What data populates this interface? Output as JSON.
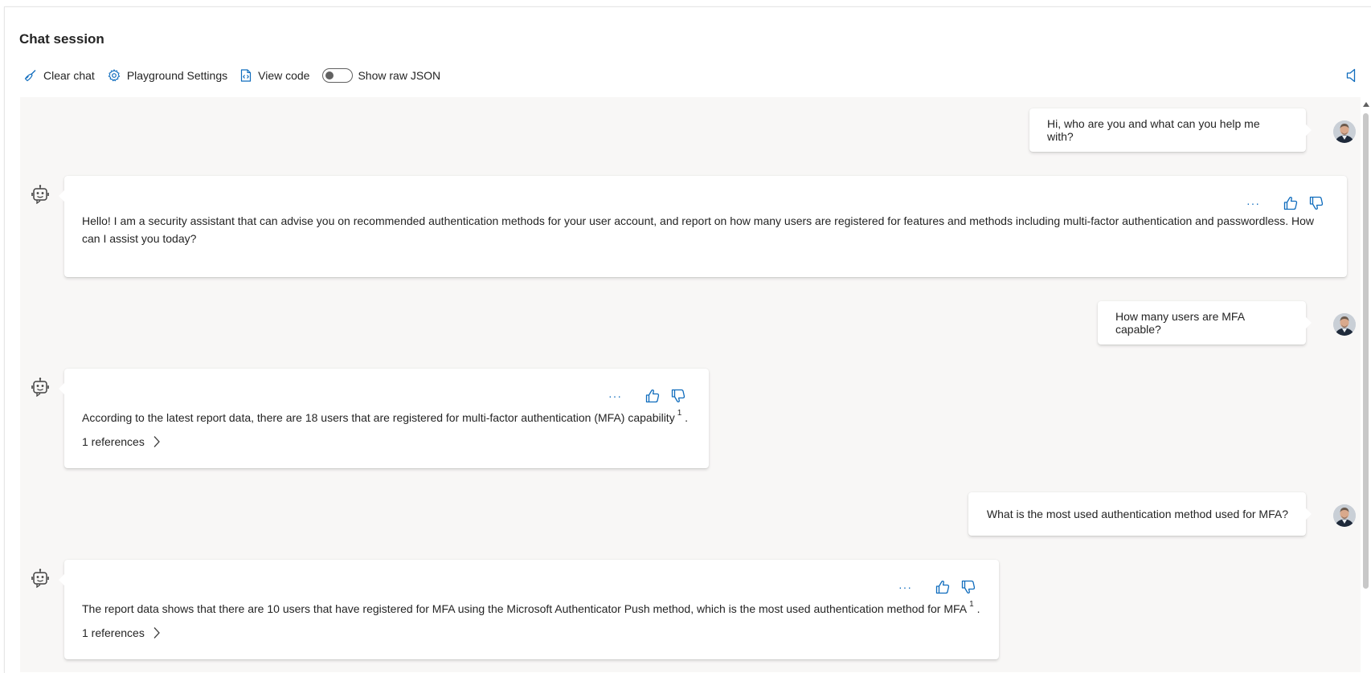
{
  "header": {
    "title": "Chat session"
  },
  "toolbar": {
    "clear_chat": "Clear chat",
    "playground_settings": "Playground Settings",
    "view_code": "View code",
    "show_raw_json": "Show raw JSON",
    "show_raw_json_on": false
  },
  "messages": [
    {
      "role": "user",
      "text": "Hi, who are you and what can you help me with?"
    },
    {
      "role": "assistant",
      "text": "Hello! I am a security assistant that can advise you on recommended authentication methods for your user account, and report on how many users are registered for features and methods including multi-factor authentication and passwordless. How can I assist you today?"
    },
    {
      "role": "user",
      "text": "How many users are MFA capable?"
    },
    {
      "role": "assistant",
      "text": "According to the latest report data, there are 18 users that are registered for multi-factor authentication (MFA) capability",
      "citation": "1",
      "end": ".",
      "references": "1 references"
    },
    {
      "role": "user",
      "text": "What is the most used authentication method used for MFA?"
    },
    {
      "role": "assistant",
      "text": "The report data shows that there are 10 users that have registered for MFA using the Microsoft Authenticator Push method, which is the most used authentication method for MFA",
      "citation": "1",
      "end": ".",
      "references": "1 references"
    }
  ],
  "actions": {
    "more": "···"
  },
  "icons": {
    "clear_chat": "broom-icon",
    "settings": "gear-icon",
    "view_code": "code-file-icon",
    "speaker": "speaker-icon",
    "bot": "bot-icon",
    "like": "thumbs-up-icon",
    "dislike": "thumbs-down-icon",
    "chevron": "chevron-right-icon"
  },
  "colors": {
    "accent": "#0f6cbd",
    "chat_background": "#f8f7f6"
  }
}
